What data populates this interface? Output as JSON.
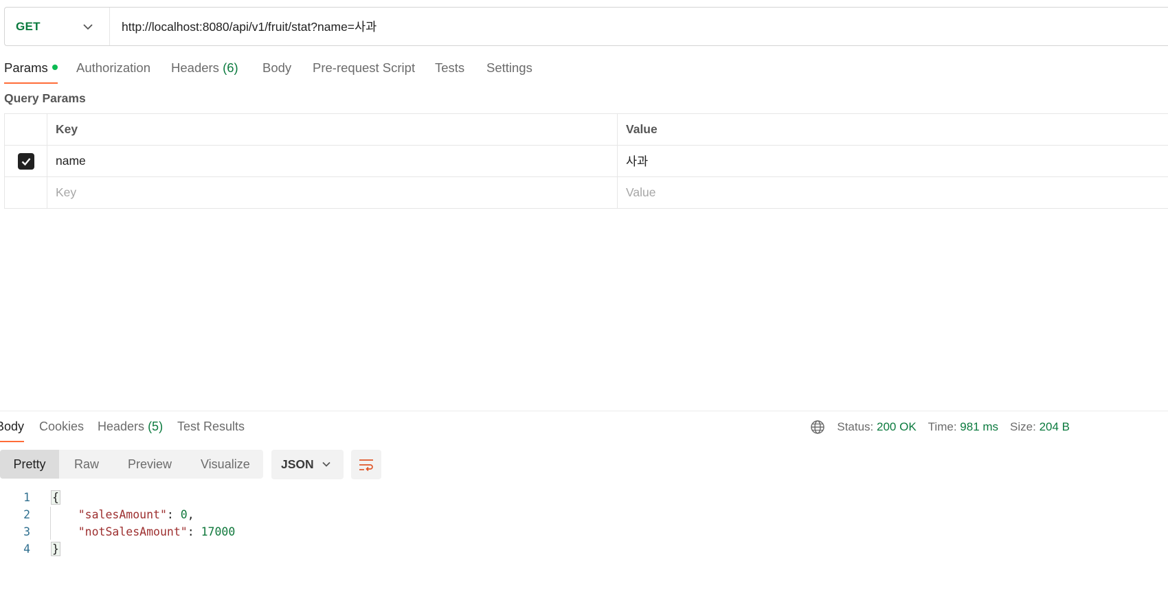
{
  "request": {
    "method": "GET",
    "url": "http://localhost:8080/api/v1/fruit/stat?name=사과"
  },
  "request_tabs": [
    {
      "label": "Params",
      "active": true,
      "has_dot": true
    },
    {
      "label": "Authorization"
    },
    {
      "label": "Headers",
      "count": "(6)"
    },
    {
      "label": "Body"
    },
    {
      "label": "Pre-request Script"
    },
    {
      "label": "Tests"
    },
    {
      "label": "Settings"
    }
  ],
  "query_params": {
    "title": "Query Params",
    "headers": {
      "key": "Key",
      "value": "Value"
    },
    "rows": [
      {
        "checked": true,
        "key": "name",
        "value": "사과"
      }
    ],
    "placeholder": {
      "key": "Key",
      "value": "Value"
    }
  },
  "response_tabs": [
    {
      "label": "Body",
      "active": true
    },
    {
      "label": "Cookies"
    },
    {
      "label": "Headers",
      "count": "(5)"
    },
    {
      "label": "Test Results"
    }
  ],
  "status": {
    "status_label": "Status:",
    "status_value": "200 OK",
    "time_label": "Time:",
    "time_value": "981 ms",
    "size_label": "Size:",
    "size_value": "204 B"
  },
  "view_modes": [
    "Pretty",
    "Raw",
    "Preview",
    "Visualize"
  ],
  "active_view_mode": "Pretty",
  "format": "JSON",
  "code": {
    "line_numbers": [
      "1",
      "2",
      "3",
      "4"
    ],
    "open_brace": "{",
    "close_brace": "}",
    "fields": [
      {
        "key": "\"salesAmount\"",
        "value": "0",
        "trail": ","
      },
      {
        "key": "\"notSalesAmount\"",
        "value": "17000",
        "trail": ""
      }
    ]
  },
  "colors": {
    "accent": "#ff6c37",
    "method_green": "#0b7a3e",
    "dot_green": "#0cbb52"
  }
}
